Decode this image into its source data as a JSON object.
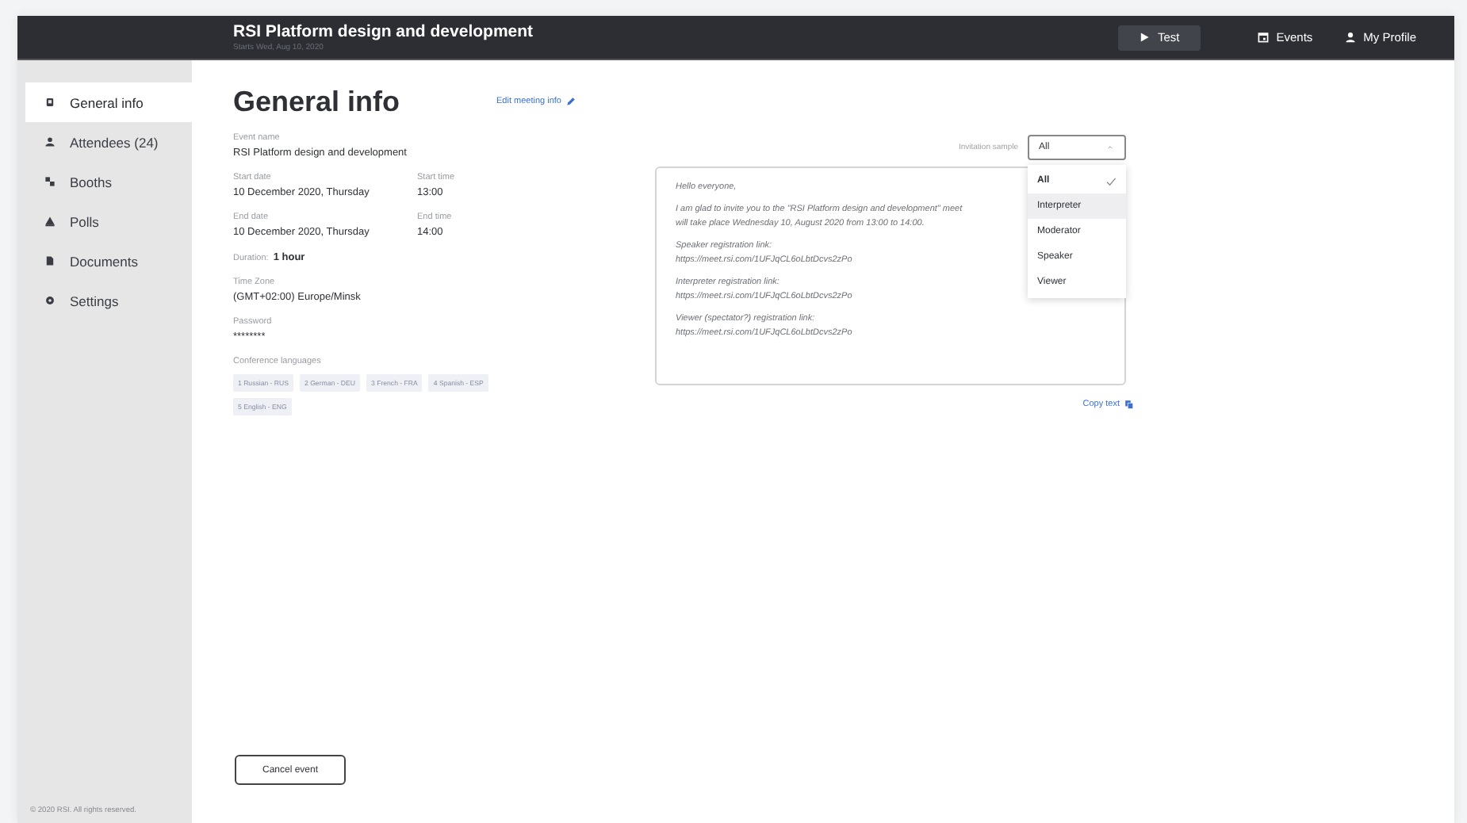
{
  "topbar": {
    "title": "RSI Platform design and development",
    "subtitle": "Starts Wed, Aug 10, 2020",
    "actions": [
      {
        "label": "Test",
        "kind": "button"
      },
      {
        "label": "Events",
        "kind": "link"
      },
      {
        "label": "My Profile",
        "kind": "link"
      }
    ]
  },
  "sidebar": {
    "items": [
      {
        "label": "General info",
        "selected": true
      },
      {
        "label": "Attendees (24)",
        "selected": false
      },
      {
        "label": "Booths",
        "selected": false
      },
      {
        "label": "Polls",
        "selected": false
      },
      {
        "label": "Documents",
        "selected": false
      },
      {
        "label": "Settings",
        "selected": false
      }
    ],
    "footer": "© 2020 RSI. All rights reserved."
  },
  "general": {
    "heading": "General info",
    "edit_link": "Edit meeting info",
    "rows": [
      [
        {
          "label": "Event name",
          "value": "RSI Platform design and development"
        }
      ],
      [
        {
          "label": "Start date",
          "value": "10 December 2020, Thursday"
        },
        {
          "label": "Start time",
          "value": "13:00"
        }
      ],
      [
        {
          "label": "End date",
          "value": "10 December 2020, Thursday"
        },
        {
          "label": "End time",
          "value": "14:00"
        }
      ],
      [
        {
          "label": "Duration:",
          "value": "1 hour",
          "kind": "inline"
        }
      ],
      [
        {
          "label": "Time Zone",
          "value": "(GMT+02:00) Europe/Minsk"
        }
      ],
      [
        {
          "label": "Password",
          "value": "********"
        }
      ]
    ],
    "languages": {
      "label": "Conference languages",
      "chips": [
        "1 Russian - RUS",
        "2 German - DEU",
        "3 French - FRA",
        "4 Spanish - ESP",
        "5 English - ENG"
      ]
    }
  },
  "invitation": {
    "label": "Invitation sample",
    "value": "All",
    "options": [
      {
        "label": "All",
        "selected": true,
        "highlighted": false
      },
      {
        "label": "Interpreter",
        "selected": false,
        "highlighted": true
      },
      {
        "label": "Moderator",
        "selected": false,
        "highlighted": false
      },
      {
        "label": "Speaker",
        "selected": false,
        "highlighted": false
      },
      {
        "label": "Viewer",
        "selected": false,
        "highlighted": false
      }
    ],
    "message": [
      [
        "Hello everyone,"
      ],
      [
        "I am glad to invite you to the \"RSI Platform design and development\" meet",
        "will take place Wednesday 10, August 2020 from 13:00 to 14:00."
      ],
      [
        "Speaker registration link:",
        "https://meet.rsi.com/1UFJqCL6oLbtDcvs2zPo"
      ],
      [
        "Interpreter registration link:",
        "https://meet.rsi.com/1UFJqCL6oLbtDcvs2zPo"
      ],
      [
        "Viewer (spectator?) registration link:",
        "https://meet.rsi.com/1UFJqCL6oLbtDcvs2zPo"
      ]
    ],
    "copy_link": "Copy text"
  },
  "cancel_button": "Cancel event"
}
